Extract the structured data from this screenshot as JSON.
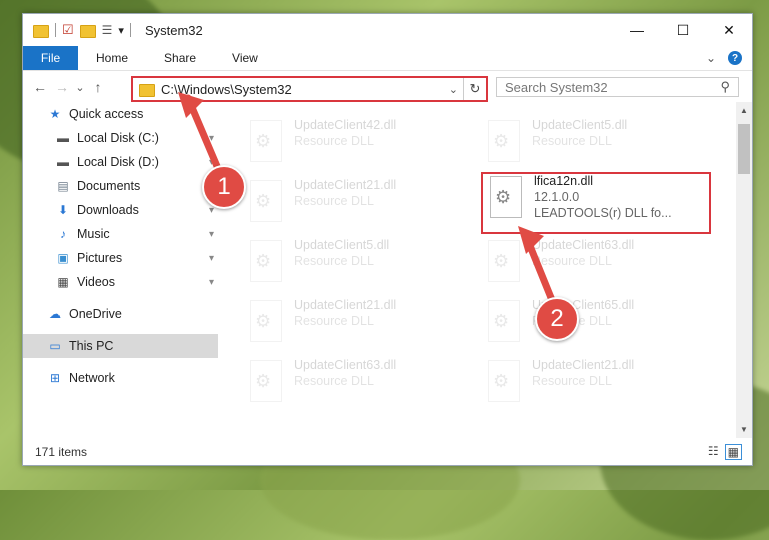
{
  "titlebar": {
    "title": "System32",
    "minimize_glyph": "—",
    "maximize_glyph": "☐",
    "close_glyph": "✕",
    "dropdown_glyph": "▾"
  },
  "ribbon": {
    "tabs": [
      "File",
      "Home",
      "Share",
      "View"
    ],
    "help_glyph": "?",
    "expand_glyph": "⌄"
  },
  "navigation": {
    "back_glyph": "←",
    "forward_glyph": "→",
    "recent_glyph": "⌄",
    "up_glyph": "↑",
    "address": "C:\\Windows\\System32",
    "address_dropdown_glyph": "⌄",
    "refresh_glyph": "↻",
    "search_placeholder": "Search System32",
    "search_glyph": "⚲"
  },
  "sidebar": {
    "items": [
      {
        "label": "Quick access",
        "icon": "star-icon",
        "glyph": "★",
        "color": "#2b78d4"
      },
      {
        "label": "Local Disk (C:)",
        "icon": "drive-icon",
        "glyph": "▬",
        "color": "#555555"
      },
      {
        "label": "Local Disk (D:)",
        "icon": "drive-icon",
        "glyph": "▬",
        "color": "#555555"
      },
      {
        "label": "Documents",
        "icon": "documents-icon",
        "glyph": "▤",
        "color": "#6d7b8a"
      },
      {
        "label": "Downloads",
        "icon": "download-icon",
        "glyph": "⬇",
        "color": "#2b78d4"
      },
      {
        "label": "Music",
        "icon": "music-icon",
        "glyph": "♪",
        "color": "#2b78d4"
      },
      {
        "label": "Pictures",
        "icon": "pictures-icon",
        "glyph": "▣",
        "color": "#3a8fd0"
      },
      {
        "label": "Videos",
        "icon": "videos-icon",
        "glyph": "▦",
        "color": "#444444"
      },
      {
        "label": "OneDrive",
        "icon": "cloud-icon",
        "glyph": "☁",
        "color": "#2b78d4"
      },
      {
        "label": "This PC",
        "icon": "computer-icon",
        "glyph": "▭",
        "color": "#2b78d4"
      },
      {
        "label": "Network",
        "icon": "network-icon",
        "glyph": "⊞",
        "color": "#2b78d4"
      }
    ],
    "pin_glyph": "📌"
  },
  "files": [
    {
      "name": "UpdateClient42.dll",
      "sub": "Resource DLL",
      "faded": true
    },
    {
      "name": "UpdateClient5.dll",
      "sub": "Resource DLL",
      "faded": true
    },
    {
      "name": "UpdateClient21.dll",
      "sub": "Resource DLL",
      "faded": true
    },
    {
      "name": "lfica12n.dll",
      "version": "12.1.0.0",
      "sub": "LEADTOOLS(r) DLL fo...",
      "faded": false
    },
    {
      "name": "UpdateClient5.dll",
      "sub": "Resource DLL",
      "faded": true
    },
    {
      "name": "UpdateClient63.dll",
      "sub": "Resource DLL",
      "faded": true
    },
    {
      "name": "UpdateClient21.dll",
      "sub": "Resource DLL",
      "faded": true
    },
    {
      "name": "UpdateClient65.dll",
      "sub": "Resource DLL",
      "faded": true
    },
    {
      "name": "UpdateClient63.dll",
      "sub": "Resource DLL",
      "faded": true
    },
    {
      "name": "UpdateClient21.dll",
      "sub": "Resource DLL",
      "faded": true
    }
  ],
  "status": {
    "count": "171 items",
    "details_glyph": "☷",
    "tiles_glyph": "▦"
  },
  "annotations": {
    "badge1": "1",
    "badge2": "2",
    "color": "#e04b44"
  }
}
